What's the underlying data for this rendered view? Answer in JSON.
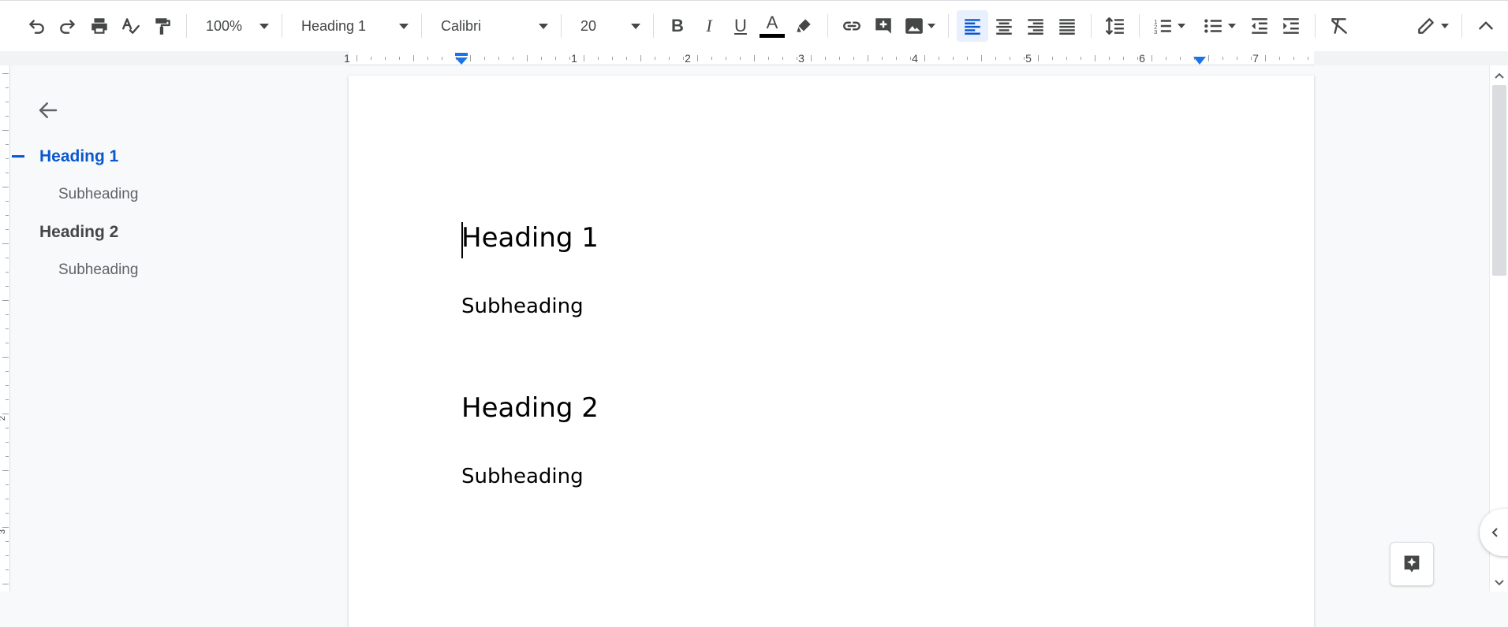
{
  "toolbar": {
    "zoom": "100%",
    "style": "Heading 1",
    "font": "Calibri",
    "size": "20",
    "buttons": {
      "undo": "undo-icon",
      "redo": "redo-icon",
      "print": "print-icon",
      "spellcheck": "spellcheck-icon",
      "paint_format": "paint-format-icon",
      "bold": "B",
      "italic": "I",
      "underline": "U",
      "text_color": "A",
      "text_color_value": "#000000",
      "highlight": "highlighter-icon",
      "link": "link-icon",
      "comment": "add-comment-icon",
      "image": "image-icon",
      "align_left": "align-left-icon",
      "align_center": "align-center-icon",
      "align_right": "align-right-icon",
      "justify": "justify-icon",
      "line_spacing": "line-spacing-icon",
      "numbered_list": "numbered-list-icon",
      "bulleted_list": "bulleted-list-icon",
      "decrease_indent": "decrease-indent-icon",
      "increase_indent": "increase-indent-icon",
      "clear_format": "clear-formatting-icon",
      "editing_mode": "pencil-icon",
      "collapse": "chevron-up-icon"
    },
    "active_alignment": "left",
    "accent": "#0b57d0"
  },
  "ruler": {
    "labels": [
      "1",
      "1",
      "2",
      "3",
      "4",
      "5",
      "6",
      "7"
    ]
  },
  "vertical_ruler": {
    "labels": [
      "2",
      "3"
    ]
  },
  "outline": {
    "back": "arrow-left-icon",
    "items": [
      {
        "label": "Heading 1",
        "level": 1,
        "active": true
      },
      {
        "label": "Subheading",
        "level": 2
      },
      {
        "label": "Heading 2",
        "level": 1
      },
      {
        "label": "Subheading",
        "level": 2
      }
    ]
  },
  "document": {
    "lines": [
      {
        "text": "Heading 1",
        "style": "heading"
      },
      {
        "text": "Subheading",
        "style": "sub"
      },
      {
        "text": "Heading 2",
        "style": "heading"
      },
      {
        "text": "Subheading",
        "style": "sub"
      }
    ]
  },
  "side_panel": {
    "toggle": "chevron-left-icon",
    "explore": "explore-icon"
  }
}
